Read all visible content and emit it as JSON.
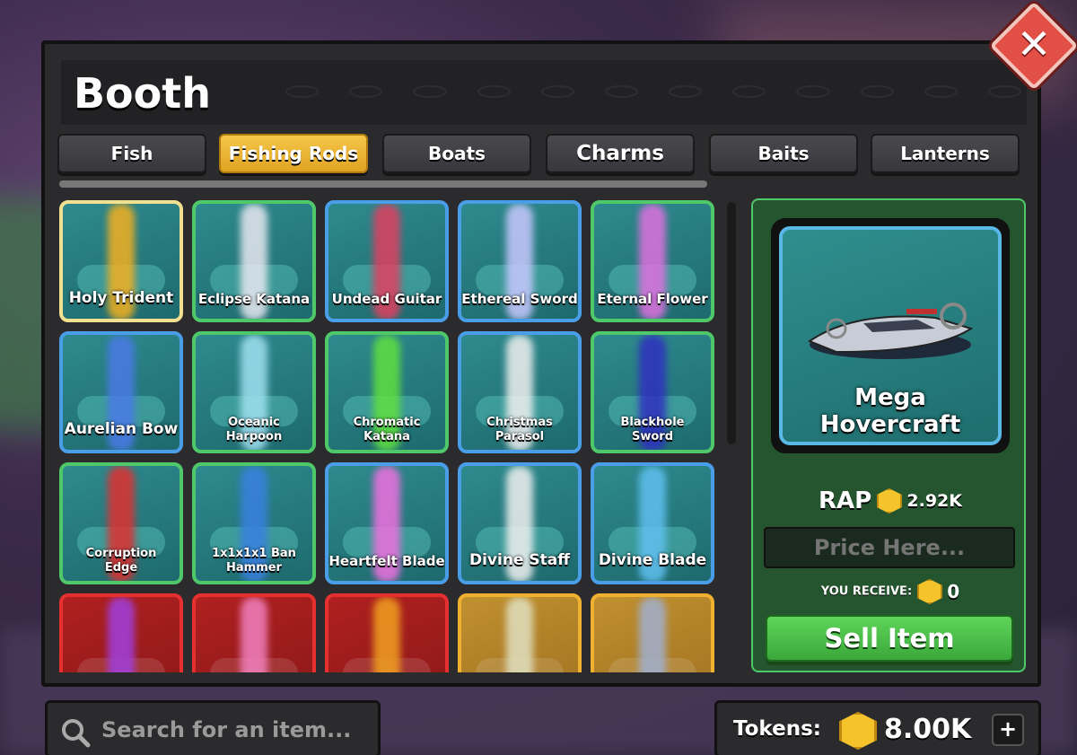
{
  "window": {
    "title": "Booth",
    "close_symbol": "✕"
  },
  "tabs": [
    {
      "label": "Fish",
      "active": false
    },
    {
      "label": "Fishing Rods",
      "active": true
    },
    {
      "label": "Boats",
      "active": false
    },
    {
      "label": "Charms",
      "active": false
    },
    {
      "label": "Baits",
      "active": false
    },
    {
      "label": "Lanterns",
      "active": false
    }
  ],
  "items": [
    {
      "name": "Holy Trident",
      "rarity_color": "#f0e090",
      "glow": "#f4b020"
    },
    {
      "name": "Eclipse Katana",
      "rarity_color": "#4fc86a",
      "glow": "#e8e8f0"
    },
    {
      "name": "Undead Guitar",
      "rarity_color": "#4a9ee8",
      "glow": "#e04060"
    },
    {
      "name": "Ethereal Sword",
      "rarity_color": "#4a9ee8",
      "glow": "#c8c8ff"
    },
    {
      "name": "Eternal Flower",
      "rarity_color": "#4fc86a",
      "glow": "#e070e0"
    },
    {
      "name": "Aurelian Bow",
      "rarity_color": "#4a9ee8",
      "glow": "#4a7ae8"
    },
    {
      "name": "Oceanic Harpoon",
      "rarity_color": "#4fc86a",
      "glow": "#a0e0f0"
    },
    {
      "name": "Chromatic Katana",
      "rarity_color": "#4fc86a",
      "glow": "#60e040"
    },
    {
      "name": "Christmas Parasol",
      "rarity_color": "#4a9ee8",
      "glow": "#f0f0f0"
    },
    {
      "name": "Blackhole Sword",
      "rarity_color": "#4fc86a",
      "glow": "#3030c0"
    },
    {
      "name": "Corruption Edge",
      "rarity_color": "#4fc86a",
      "glow": "#e03030"
    },
    {
      "name": "1x1x1x1 Ban Hammer",
      "rarity_color": "#4fc86a",
      "glow": "#3a80e0"
    },
    {
      "name": "Heartfelt Blade",
      "rarity_color": "#4a9ee8",
      "glow": "#f070e0"
    },
    {
      "name": "Divine Staff",
      "rarity_color": "#4a9ee8",
      "glow": "#f0f0f0"
    },
    {
      "name": "Divine Blade",
      "rarity_color": "#4a9ee8",
      "glow": "#60c0f0"
    }
  ],
  "partial_row": [
    {
      "tier": "red",
      "glow": "#a040e0"
    },
    {
      "tier": "red",
      "glow": "#f080c0"
    },
    {
      "tier": "red",
      "glow": "#f0a020"
    },
    {
      "tier": "yellow",
      "glow": "#e0e0c0"
    },
    {
      "tier": "yellow",
      "glow": "#a0b0d0"
    }
  ],
  "detail": {
    "item_name": "Mega Hovercraft",
    "rap_label": "RAP",
    "rap_value": "2.92K",
    "price_placeholder": "Price Here...",
    "receive_label": "YOU RECEIVE:",
    "receive_value": "0",
    "sell_label": "Sell Item"
  },
  "search": {
    "placeholder": "Search for an item..."
  },
  "tokens": {
    "label": "Tokens:",
    "value": "8.00K",
    "plus": "+"
  },
  "colors": {
    "active_tab": "#f0b030",
    "sell_button": "#4cc04a",
    "coin": "#f5c42a",
    "close": "#e24f46"
  }
}
